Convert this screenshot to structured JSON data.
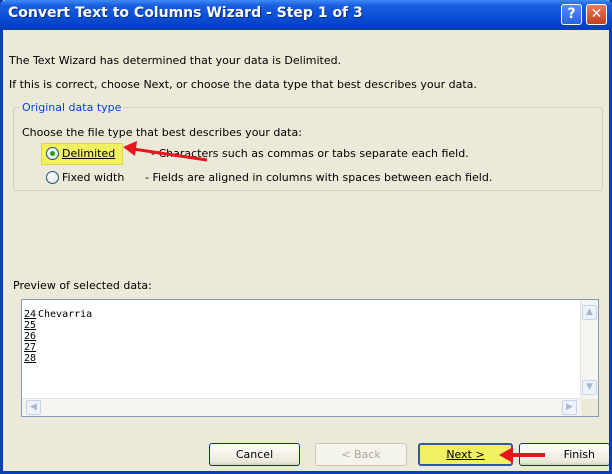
{
  "window": {
    "title": "Convert Text to Columns Wizard - Step 1 of 3",
    "help_glyph": "?",
    "close_glyph": "✕"
  },
  "intro": {
    "line1": "The Text Wizard has determined that your data is Delimited.",
    "line2": "If this is correct, choose Next, or choose the data type that best describes your data."
  },
  "data_type_group": {
    "legend": "Original data type",
    "prompt": "Choose the file type that best describes your data:",
    "options": [
      {
        "label": "Delimited",
        "description": "- Characters such as commas or tabs separate each field.",
        "selected": true
      },
      {
        "label": "Fixed width",
        "description": "- Fields are aligned in columns with spaces between each field.",
        "selected": false
      }
    ]
  },
  "preview": {
    "label": "Preview of selected data:",
    "rows": [
      {
        "num": "24",
        "text": "Chevarria"
      },
      {
        "num": "25",
        "text": ""
      },
      {
        "num": "26",
        "text": ""
      },
      {
        "num": "27",
        "text": ""
      },
      {
        "num": "28",
        "text": ""
      }
    ]
  },
  "buttons": {
    "cancel": "Cancel",
    "back": "< Back",
    "next": "Next >",
    "finish": "Finish"
  },
  "colors": {
    "highlight": "#f0f060",
    "arrow": "#e8141e",
    "accent": "#0046d5"
  }
}
